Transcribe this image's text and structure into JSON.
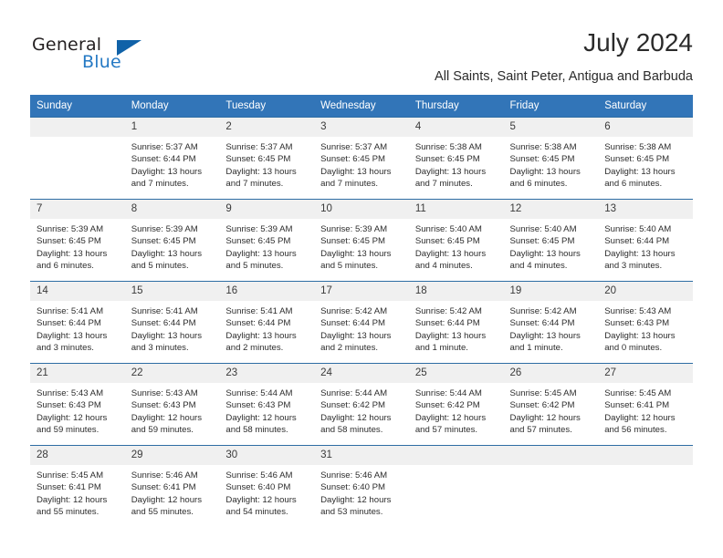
{
  "brand": {
    "name_part1": "General",
    "name_part2": "Blue"
  },
  "header": {
    "title": "July 2024",
    "subtitle": "All Saints, Saint Peter, Antigua and Barbuda"
  },
  "colors": {
    "header_blue": "#3275b8",
    "row_line_blue": "#2e6da4",
    "daynum_band": "#f0f0f0",
    "brand_blue": "#2579c4",
    "logo_triangle": "#1062a8"
  },
  "weekday_headers": [
    "Sunday",
    "Monday",
    "Tuesday",
    "Wednesday",
    "Thursday",
    "Friday",
    "Saturday"
  ],
  "weeks": [
    [
      {
        "day": "",
        "lines": []
      },
      {
        "day": "1",
        "lines": [
          "Sunrise: 5:37 AM",
          "Sunset: 6:44 PM",
          "Daylight: 13 hours",
          "and 7 minutes."
        ]
      },
      {
        "day": "2",
        "lines": [
          "Sunrise: 5:37 AM",
          "Sunset: 6:45 PM",
          "Daylight: 13 hours",
          "and 7 minutes."
        ]
      },
      {
        "day": "3",
        "lines": [
          "Sunrise: 5:37 AM",
          "Sunset: 6:45 PM",
          "Daylight: 13 hours",
          "and 7 minutes."
        ]
      },
      {
        "day": "4",
        "lines": [
          "Sunrise: 5:38 AM",
          "Sunset: 6:45 PM",
          "Daylight: 13 hours",
          "and 7 minutes."
        ]
      },
      {
        "day": "5",
        "lines": [
          "Sunrise: 5:38 AM",
          "Sunset: 6:45 PM",
          "Daylight: 13 hours",
          "and 6 minutes."
        ]
      },
      {
        "day": "6",
        "lines": [
          "Sunrise: 5:38 AM",
          "Sunset: 6:45 PM",
          "Daylight: 13 hours",
          "and 6 minutes."
        ]
      }
    ],
    [
      {
        "day": "7",
        "lines": [
          "Sunrise: 5:39 AM",
          "Sunset: 6:45 PM",
          "Daylight: 13 hours",
          "and 6 minutes."
        ]
      },
      {
        "day": "8",
        "lines": [
          "Sunrise: 5:39 AM",
          "Sunset: 6:45 PM",
          "Daylight: 13 hours",
          "and 5 minutes."
        ]
      },
      {
        "day": "9",
        "lines": [
          "Sunrise: 5:39 AM",
          "Sunset: 6:45 PM",
          "Daylight: 13 hours",
          "and 5 minutes."
        ]
      },
      {
        "day": "10",
        "lines": [
          "Sunrise: 5:39 AM",
          "Sunset: 6:45 PM",
          "Daylight: 13 hours",
          "and 5 minutes."
        ]
      },
      {
        "day": "11",
        "lines": [
          "Sunrise: 5:40 AM",
          "Sunset: 6:45 PM",
          "Daylight: 13 hours",
          "and 4 minutes."
        ]
      },
      {
        "day": "12",
        "lines": [
          "Sunrise: 5:40 AM",
          "Sunset: 6:45 PM",
          "Daylight: 13 hours",
          "and 4 minutes."
        ]
      },
      {
        "day": "13",
        "lines": [
          "Sunrise: 5:40 AM",
          "Sunset: 6:44 PM",
          "Daylight: 13 hours",
          "and 3 minutes."
        ]
      }
    ],
    [
      {
        "day": "14",
        "lines": [
          "Sunrise: 5:41 AM",
          "Sunset: 6:44 PM",
          "Daylight: 13 hours",
          "and 3 minutes."
        ]
      },
      {
        "day": "15",
        "lines": [
          "Sunrise: 5:41 AM",
          "Sunset: 6:44 PM",
          "Daylight: 13 hours",
          "and 3 minutes."
        ]
      },
      {
        "day": "16",
        "lines": [
          "Sunrise: 5:41 AM",
          "Sunset: 6:44 PM",
          "Daylight: 13 hours",
          "and 2 minutes."
        ]
      },
      {
        "day": "17",
        "lines": [
          "Sunrise: 5:42 AM",
          "Sunset: 6:44 PM",
          "Daylight: 13 hours",
          "and 2 minutes."
        ]
      },
      {
        "day": "18",
        "lines": [
          "Sunrise: 5:42 AM",
          "Sunset: 6:44 PM",
          "Daylight: 13 hours",
          "and 1 minute."
        ]
      },
      {
        "day": "19",
        "lines": [
          "Sunrise: 5:42 AM",
          "Sunset: 6:44 PM",
          "Daylight: 13 hours",
          "and 1 minute."
        ]
      },
      {
        "day": "20",
        "lines": [
          "Sunrise: 5:43 AM",
          "Sunset: 6:43 PM",
          "Daylight: 13 hours",
          "and 0 minutes."
        ]
      }
    ],
    [
      {
        "day": "21",
        "lines": [
          "Sunrise: 5:43 AM",
          "Sunset: 6:43 PM",
          "Daylight: 12 hours",
          "and 59 minutes."
        ]
      },
      {
        "day": "22",
        "lines": [
          "Sunrise: 5:43 AM",
          "Sunset: 6:43 PM",
          "Daylight: 12 hours",
          "and 59 minutes."
        ]
      },
      {
        "day": "23",
        "lines": [
          "Sunrise: 5:44 AM",
          "Sunset: 6:43 PM",
          "Daylight: 12 hours",
          "and 58 minutes."
        ]
      },
      {
        "day": "24",
        "lines": [
          "Sunrise: 5:44 AM",
          "Sunset: 6:42 PM",
          "Daylight: 12 hours",
          "and 58 minutes."
        ]
      },
      {
        "day": "25",
        "lines": [
          "Sunrise: 5:44 AM",
          "Sunset: 6:42 PM",
          "Daylight: 12 hours",
          "and 57 minutes."
        ]
      },
      {
        "day": "26",
        "lines": [
          "Sunrise: 5:45 AM",
          "Sunset: 6:42 PM",
          "Daylight: 12 hours",
          "and 57 minutes."
        ]
      },
      {
        "day": "27",
        "lines": [
          "Sunrise: 5:45 AM",
          "Sunset: 6:41 PM",
          "Daylight: 12 hours",
          "and 56 minutes."
        ]
      }
    ],
    [
      {
        "day": "28",
        "lines": [
          "Sunrise: 5:45 AM",
          "Sunset: 6:41 PM",
          "Daylight: 12 hours",
          "and 55 minutes."
        ]
      },
      {
        "day": "29",
        "lines": [
          "Sunrise: 5:46 AM",
          "Sunset: 6:41 PM",
          "Daylight: 12 hours",
          "and 55 minutes."
        ]
      },
      {
        "day": "30",
        "lines": [
          "Sunrise: 5:46 AM",
          "Sunset: 6:40 PM",
          "Daylight: 12 hours",
          "and 54 minutes."
        ]
      },
      {
        "day": "31",
        "lines": [
          "Sunrise: 5:46 AM",
          "Sunset: 6:40 PM",
          "Daylight: 12 hours",
          "and 53 minutes."
        ]
      },
      {
        "day": "",
        "lines": []
      },
      {
        "day": "",
        "lines": []
      },
      {
        "day": "",
        "lines": []
      }
    ]
  ]
}
